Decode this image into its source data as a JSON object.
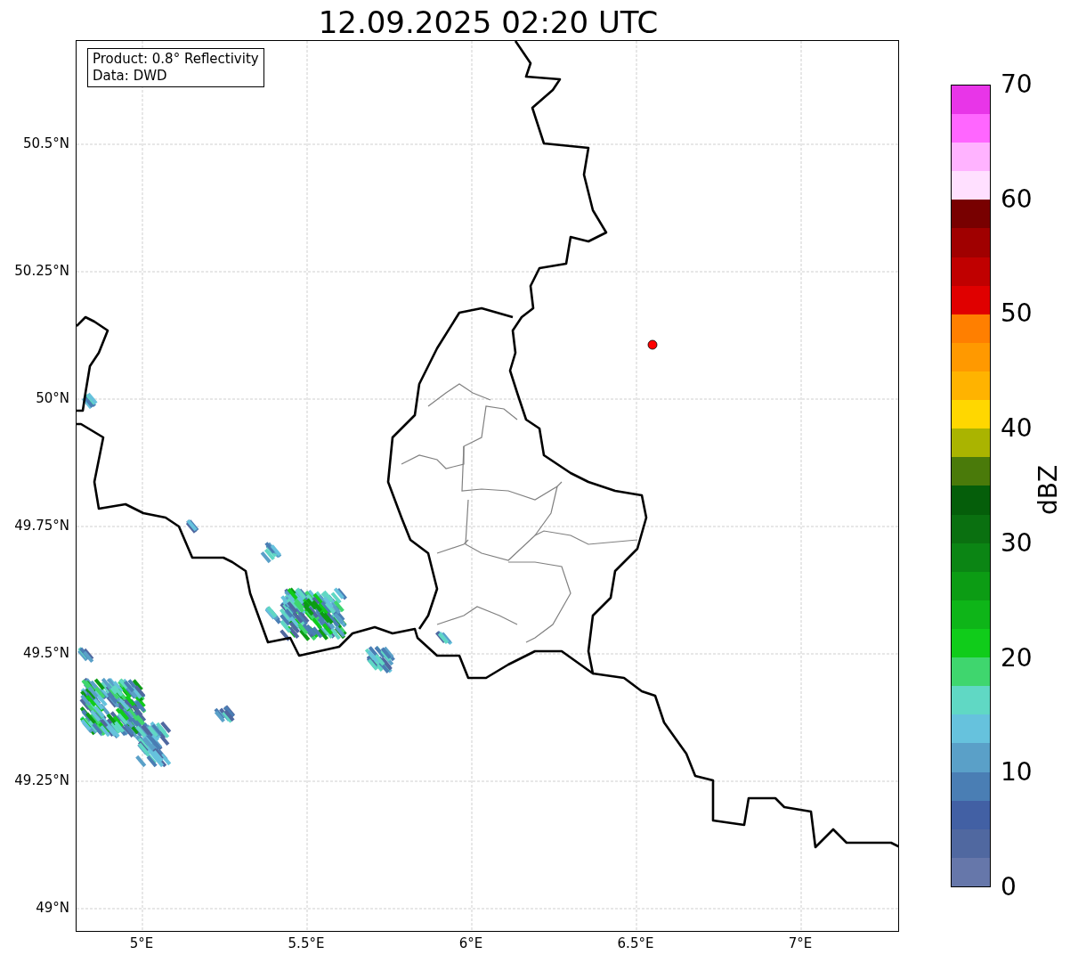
{
  "title": "12.09.2025 02:20 UTC",
  "info_box": {
    "lines": [
      "Product: 0.8° Reflectivity",
      "Data: DWD"
    ]
  },
  "map": {
    "lat_ticks": [
      "50.5°N",
      "50.25°N",
      "50°N",
      "49.75°N",
      "49.5°N",
      "49.25°N",
      "49°N"
    ],
    "lon_ticks": [
      "5°E",
      "5.5°E",
      "6°E",
      "6.5°E",
      "7°E"
    ]
  },
  "colorbar": {
    "label": "dBZ",
    "ticks": [
      "70",
      "60",
      "50",
      "40",
      "30",
      "20",
      "10",
      "0"
    ],
    "levels": [
      {
        "color": "#6677aa"
      },
      {
        "color": "#5068a0"
      },
      {
        "color": "#4260a4"
      },
      {
        "color": "#4a7eb4"
      },
      {
        "color": "#5aa0c8"
      },
      {
        "color": "#66c2dd"
      },
      {
        "color": "#60d8c4"
      },
      {
        "color": "#3fd66e"
      },
      {
        "color": "#10cc1a"
      },
      {
        "color": "#0eb518"
      },
      {
        "color": "#0c9c14"
      },
      {
        "color": "#0b8514"
      },
      {
        "color": "#0a7010"
      },
      {
        "color": "#055e0a"
      },
      {
        "color": "#4a7a0a"
      },
      {
        "color": "#aab400"
      },
      {
        "color": "#ffd700"
      },
      {
        "color": "#ffb300"
      },
      {
        "color": "#ff9900"
      },
      {
        "color": "#ff7f00"
      },
      {
        "color": "#e00000"
      },
      {
        "color": "#c00000"
      },
      {
        "color": "#a00000"
      },
      {
        "color": "#780000"
      },
      {
        "color": "#ffe0ff"
      },
      {
        "color": "#ffb3ff"
      },
      {
        "color": "#ff66ff"
      },
      {
        "color": "#e835e8"
      }
    ]
  }
}
